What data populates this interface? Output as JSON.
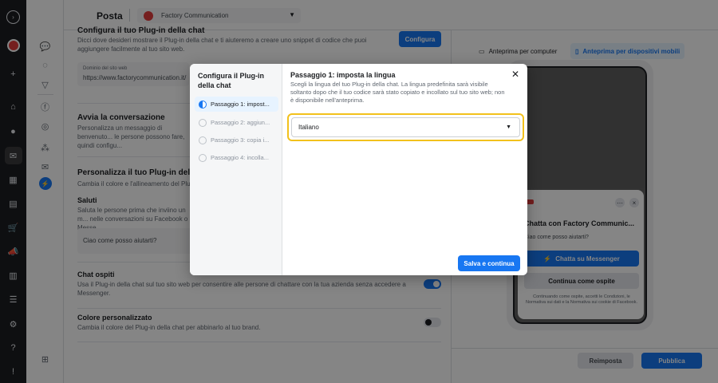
{
  "header": {
    "title": "Posta",
    "page_name": "Factory Communication"
  },
  "main": {
    "configure": {
      "title": "Configura il tuo Plug-in della chat",
      "text": "Dicci dove desideri mostrare il Plug-in della chat e ti aiuteremo a creare uno snippet di codice che puoi aggiungere facilmente al tuo sito web.",
      "button": "Configura",
      "domain_label": "Dominio del sito web",
      "domain_value": "https://www.factorycommunication.it/"
    },
    "start": {
      "title": "Avvia la conversazione",
      "text": "Personalizza un messaggio di benvenuto... le persone possono fare, quindi configu..."
    },
    "customize": {
      "title": "Personalizza il tuo Plug-in della chat",
      "text": "Cambia il colore e l'allineamento del Plu..."
    },
    "greeting": {
      "title": "Saluti",
      "text": "Saluta le persone prima che inviino un m... nelle conversazioni su Facebook o Messe...",
      "field_value": "Ciao come posso aiutarti?"
    },
    "guest": {
      "title": "Chat ospiti",
      "text": "Usa il Plug-in della chat sul tuo sito web per consentire alle persone di chattare con la tua azienda senza accedere a Messenger.",
      "enabled": true
    },
    "color": {
      "title": "Colore personalizzato",
      "text": "Cambia il colore del Plug-in della chat per abbinarlo al tuo brand.",
      "enabled": false
    }
  },
  "preview": {
    "tab_computer": "Anteprima per computer",
    "tab_mobile": "Anteprima per dispositivi mobili",
    "chat_title": "Chatta con Factory Communic...",
    "chat_sub": "Ciao come posso aiutarti?",
    "btn_messenger": "Chatta su Messenger",
    "btn_guest": "Continua come ospite",
    "terms": "Continuando come ospite, accetti le Condizioni, le Normativa sui dati e la Normativa sui cookie di Facebook."
  },
  "bottom": {
    "reset": "Reimposta",
    "publish": "Pubblica"
  },
  "modal": {
    "side_title": "Configura il Plug-in della chat",
    "steps": [
      "Passaggio 1: impost...",
      "Passaggio 2: aggiun...",
      "Passaggio 3: copia i...",
      "Passaggio 4: incolla..."
    ],
    "title": "Passaggio 1: imposta la lingua",
    "description": "Scegli la lingua del tuo Plug-in della chat. La lingua predefinita sarà visibile soltanto dopo che il tuo codice sarà stato copiato e incollato sul tuo sito web; non è disponibile nell'anteprima.",
    "language_value": "Italiano",
    "save_button": "Salva e continua"
  },
  "colors": {
    "accent": "#1877f2",
    "highlight": "#f2c11c"
  }
}
